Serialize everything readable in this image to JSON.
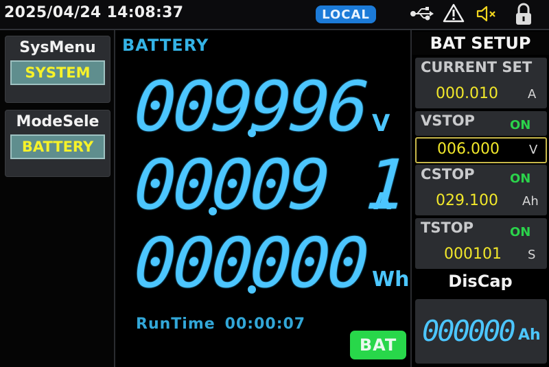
{
  "status_bar": {
    "datetime": "2025/04/24 14:08:37",
    "local_label": "LOCAL",
    "icons": [
      "usb-icon",
      "warning-icon",
      "mute-icon",
      "lock-icon"
    ]
  },
  "left_panel": {
    "sysmenu": {
      "title": "SysMenu",
      "value": "SYSTEM"
    },
    "modesel": {
      "title": "ModeSele",
      "value": "BATTERY"
    }
  },
  "main": {
    "mode_label": "BATTERY",
    "voltage": {
      "value": "009996",
      "unit": "V"
    },
    "current": {
      "value": "00009 1",
      "unit": "A"
    },
    "energy": {
      "value": "000000",
      "unit": "Wh"
    },
    "runtime_label": "RunTime",
    "runtime_value": "00:00:07",
    "bat_badge": "BAT"
  },
  "setup": {
    "title": "BAT SETUP",
    "current_set": {
      "label": "CURRENT SET",
      "value": "000.010",
      "unit": "A"
    },
    "vstop": {
      "label": "VSTOP",
      "state": "ON",
      "value": "006.000",
      "unit": "V"
    },
    "cstop": {
      "label": "CSTOP",
      "state": "ON",
      "value": "029.100",
      "unit": "Ah"
    },
    "tstop": {
      "label": "TSTOP",
      "state": "ON",
      "value": "000101",
      "unit": "S"
    },
    "discap": {
      "label": "DisCap",
      "value": "000000",
      "unit": "Ah"
    }
  },
  "colors": {
    "lcd_blue": "#4cc6ff",
    "yellow": "#f2e82a",
    "green": "#28d74a",
    "local_blue": "#1c7bd8"
  }
}
